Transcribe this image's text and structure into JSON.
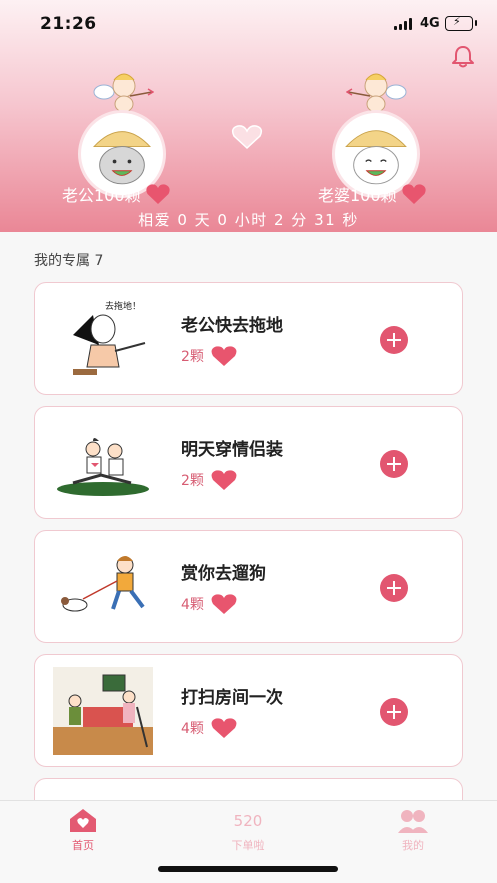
{
  "status_bar": {
    "time": "21:26",
    "network": "4G"
  },
  "couple": {
    "left": {
      "label": "老公100颗"
    },
    "right": {
      "label": "老婆100颗"
    },
    "timer": "相爱 0 天 0 小时 2 分 31 秒"
  },
  "section": {
    "title": "我的专属 7"
  },
  "tasks": [
    {
      "title": "老公快去拖地",
      "points": "2颗",
      "image_caption": "去拖地！"
    },
    {
      "title": "明天穿情侣装",
      "points": "2颗"
    },
    {
      "title": "赏你去遛狗",
      "points": "4颗"
    },
    {
      "title": "打扫房间一次",
      "points": "4颗"
    }
  ],
  "tabbar": {
    "home": {
      "label": "首页",
      "active": true
    },
    "order": {
      "label": "下单啦",
      "icon_text": "520"
    },
    "mine": {
      "label": "我的"
    }
  },
  "colors": {
    "accent": "#e25670",
    "heart": "#e8556e",
    "card_border": "#f0c9d0"
  }
}
